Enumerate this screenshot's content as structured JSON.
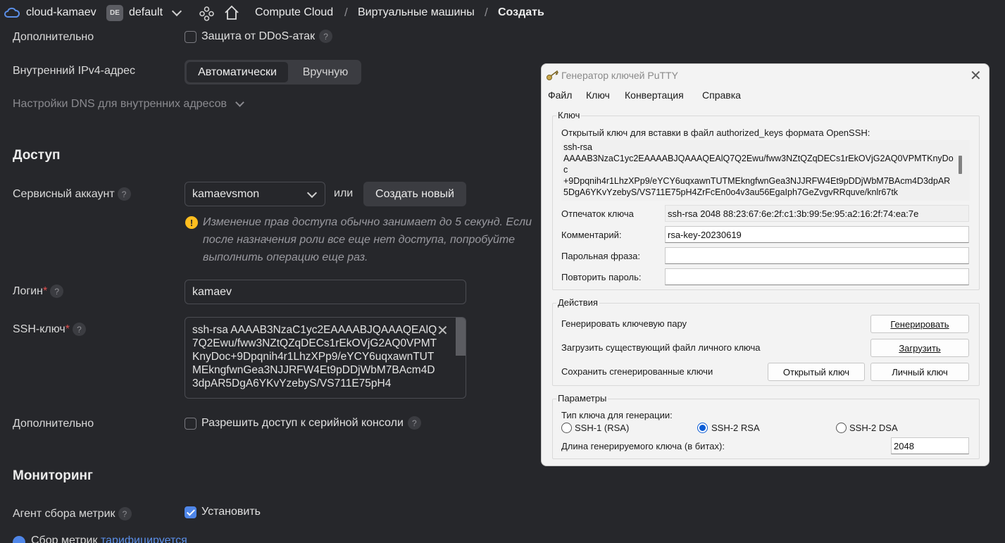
{
  "topbar": {
    "cloud": "cloud-kamaev",
    "folder_badge": "DE",
    "folder": "default",
    "breadcrumb": [
      "Compute Cloud",
      "Виртуальные машины",
      "Создать"
    ],
    "separator": "/"
  },
  "form": {
    "extra1_label": "Дополнительно",
    "ddos_label": "Защита от DDoS-атак",
    "ipv4_label": "Внутренний IPv4-адрес",
    "ipv4_auto": "Автоматически",
    "ipv4_manual": "Вручную",
    "dns_label": "Настройки DNS для внутренних адресов",
    "access_title": "Доступ",
    "service_account_label": "Сервисный аккаунт",
    "service_account_value": "kamaevsmon",
    "or_text": "или",
    "create_new": "Создать новый",
    "warning": "Изменение прав доступа обычно занимает до 5 секунд. Если после назначения роли все еще нет доступа, попробуйте выполнить операцию еще раз.",
    "login_label": "Логин",
    "login_value": "kamaev",
    "ssh_label": "SSH-ключ",
    "ssh_value": "ssh-rsa AAAAB3NzaC1yc2EAAAABJQAAAQEAlQ7Q2Ewu/fww3NZtQZqDECs1rEkOVjG2AQ0VPMTKnyDoc+9Dpqnih4r1LhzXPp9/eYCY6uqxawnTUTMEkngfwnGea3NJJRFW4Et9pDDjWbM7BAcm4D3dpAR5DgA6YKvYzebyS/VS711E75pH4",
    "extra2_label": "Дополнительно",
    "serial_label": "Разрешить доступ к серийной консоли",
    "monitoring_title": "Мониторинг",
    "agent_label": "Агент сбора метрик",
    "agent_checkbox": "Установить",
    "billing_text": "Сбор метрик",
    "billing_link": "тарифицируется"
  },
  "putty": {
    "title": "Генератор ключей PuTTY",
    "menu": [
      "Файл",
      "Ключ",
      "Конвертация",
      "Справка"
    ],
    "key_group": "Ключ",
    "public_key_label": "Открытый ключ для вставки в файл authorized_keys формата OpenSSH:",
    "public_key": "ssh-rsa\nAAAAB3NzaC1yc2EAAAABJQAAAQEAlQ7Q2Ewu/fww3NZtQZqDECs1rEkOVjG2AQ0VPMTKnyDoc\n+9Dpqnih4r1LhzXPp9/eYCY6uqxawnTUTMEkngfwnGea3NJJRFW4Et9pDDjWbM7BAcm4D3dpAR5DgA6YKvYzebyS/VS711E75pH4ZrFcEn0o4v3au56EgaIph7GeZvgvRRquve/knlr67tk",
    "fingerprint_label": "Отпечаток ключа",
    "fingerprint": "ssh-rsa 2048 88:23:67:6e:2f:c1:3b:99:5e:95:a2:16:2f:74:ea:7e",
    "comment_label": "Комментарий:",
    "comment": "rsa-key-20230619",
    "passphrase_label": "Парольная фраза:",
    "confirm_label": "Повторить пароль:",
    "actions_group": "Действия",
    "gen_label": "Генерировать ключевую пару",
    "gen_btn": "Генерировать",
    "load_label": "Загрузить существующий файл личного ключа",
    "load_btn": "Загрузить",
    "save_label": "Сохранить сгенерированные ключи",
    "save_public_btn": "Открытый ключ",
    "save_private_btn": "Личный ключ",
    "params_group": "Параметры",
    "keytype_label": "Тип ключа для генерации:",
    "rsa1": "SSH-1 (RSA)",
    "rsa2": "SSH-2 RSA",
    "dsa2": "SSH-2 DSA",
    "bits_label": "Длина генерируемого ключа (в битах):",
    "bits": "2048",
    "selected_type": "SSH-2 RSA"
  },
  "colors": {
    "background": "#26272b",
    "accent": "#4f86e8",
    "warning": "#ffbe1f",
    "required": "#e05050"
  }
}
